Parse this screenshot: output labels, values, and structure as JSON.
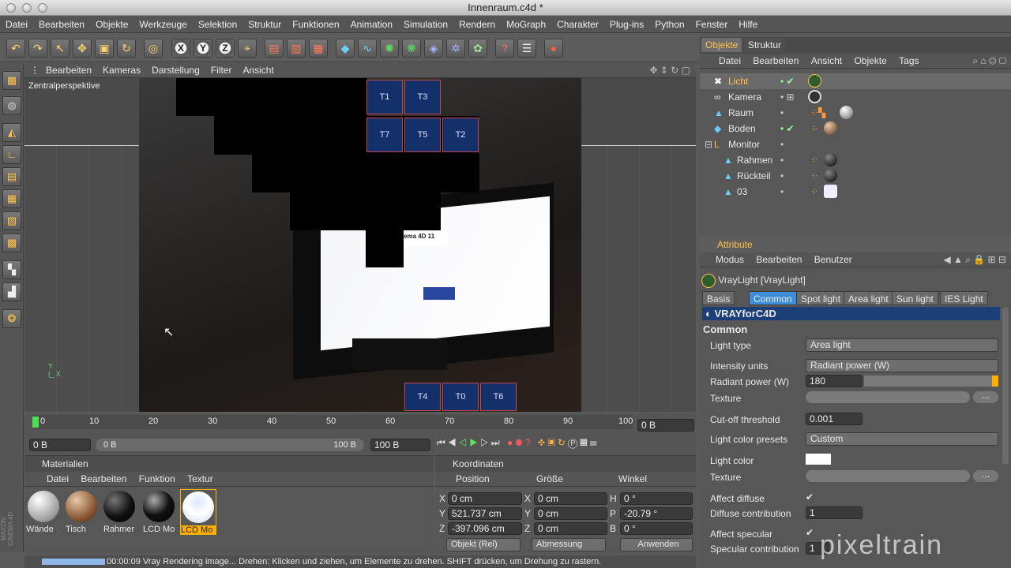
{
  "window": {
    "title": "Innenraum.c4d *"
  },
  "menu": [
    "Datei",
    "Bearbeiten",
    "Objekte",
    "Werkzeuge",
    "Selektion",
    "Struktur",
    "Funktionen",
    "Animation",
    "Simulation",
    "Rendern",
    "MoGraph",
    "Charakter",
    "Plug-ins",
    "Python",
    "Fenster",
    "Hilfe"
  ],
  "viewport": {
    "menu": [
      "Bearbeiten",
      "Kameras",
      "Darstellung",
      "Filter",
      "Ansicht"
    ],
    "label": "Zentralperspektive",
    "tiles": [
      "T1",
      "T3",
      "T7",
      "T5",
      "T2",
      "T4",
      "T0",
      "T6"
    ],
    "monitor_text": "ema 4D 11"
  },
  "timeline": {
    "ticks": [
      "0",
      "10",
      "20",
      "30",
      "40",
      "50",
      "60",
      "70",
      "80",
      "90",
      "100"
    ],
    "frame": "0 B",
    "start": "0 B",
    "range_start": "0 B",
    "range_end": "100 B",
    "end": "100 B"
  },
  "materials": {
    "title": "Materialien",
    "menu": [
      "Datei",
      "Bearbeiten",
      "Funktion",
      "Textur"
    ],
    "items": [
      "Wände",
      "Tisch",
      "Rahmer",
      "LCD Mo",
      "LCD Mo"
    ]
  },
  "coords": {
    "title": "Koordinaten",
    "headers": [
      "Position",
      "Größe",
      "Winkel"
    ],
    "rows": [
      {
        "a": "X",
        "p": "0 cm",
        "b": "X",
        "s": "0 cm",
        "c": "H",
        "w": "0 °"
      },
      {
        "a": "Y",
        "p": "521.737 cm",
        "b": "Y",
        "s": "0 cm",
        "c": "P",
        "w": "-20.79 °"
      },
      {
        "a": "Z",
        "p": "-397.096 cm",
        "b": "Z",
        "s": "0 cm",
        "c": "B",
        "w": "0 °"
      }
    ],
    "mode": "Objekt (Rel)",
    "size_mode": "Abmessung",
    "apply": "Anwenden"
  },
  "status": {
    "text": "00:00:09 Vray Rendering image...   Drehen: Klicken und ziehen, um Elemente zu drehen. SHIFT drücken, um Drehung zu rastern."
  },
  "objects": {
    "tabs": [
      "Objekte",
      "Struktur"
    ],
    "menu": [
      "Datei",
      "Bearbeiten",
      "Ansicht",
      "Objekte",
      "Tags"
    ],
    "items": [
      "Licht",
      "Kamera",
      "Raum",
      "Boden",
      "Monitor",
      "Rahmen",
      "Rückteil",
      "03"
    ]
  },
  "attributes": {
    "title": "Attribute",
    "menu": [
      "Modus",
      "Bearbeiten",
      "Benutzer"
    ],
    "object": "VrayLight [VrayLight]",
    "tabs": [
      "Basis",
      "Common",
      "Spot light",
      "Area light",
      "Sun light",
      "IES Light"
    ],
    "banner": "VRAYforC4D",
    "section": "Common",
    "light_type_label": "Light type",
    "light_type": "Area light",
    "intensity_units_label": "Intensity units",
    "intensity_units": "Radiant power (W)",
    "radiant_power_label": "Radiant power (W)",
    "radiant_power": "180",
    "texture_label": "Texture",
    "cutoff_label": "Cut-off threshold",
    "cutoff": "0.001",
    "presets_label": "Light color presets",
    "presets": "Custom",
    "color_label": "Light color",
    "light_color": "#ffffff",
    "texture2_label": "Texture",
    "affect_diffuse_label": "Affect diffuse",
    "diffuse_contrib_label": "Diffuse contribution",
    "diffuse_contrib": "1",
    "affect_specular_label": "Affect specular",
    "specular_contrib_label": "Specular contribution",
    "specular_contrib": "1"
  },
  "watermark": "pixeltrain",
  "brand_vertical": "MAXON CINEMA 4D"
}
